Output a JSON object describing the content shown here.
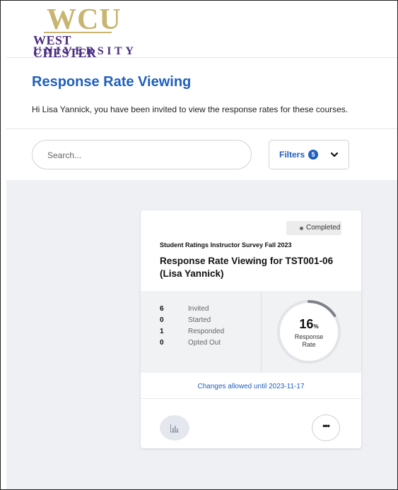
{
  "logo": {
    "mark": "WCU",
    "line1": "WEST CHESTER",
    "line2": "UNIVERSITY"
  },
  "page": {
    "title": "Response Rate Viewing",
    "intro": "Hi Lisa Yannick, you have been invited to view the response rates for these courses."
  },
  "search": {
    "placeholder": "Search..."
  },
  "filters": {
    "label": "Filters",
    "count": "5",
    "icon": "chevron-down-icon"
  },
  "card": {
    "status": "Completed",
    "survey_name": "Student Ratings Instructor Survey Fall 2023",
    "course_title": "Response Rate Viewing for TST001-06 (Lisa Yannick)",
    "stats": [
      {
        "value": "6",
        "label": "Invited"
      },
      {
        "value": "0",
        "label": "Started"
      },
      {
        "value": "1",
        "label": "Responded"
      },
      {
        "value": "0",
        "label": "Opted Out"
      }
    ],
    "response_rate": {
      "value": "16",
      "unit": "%",
      "fraction": 0.16,
      "label_line1": "Response",
      "label_line2": "Rate"
    },
    "changes_note": "Changes allowed until 2023-11-17",
    "chart_button_icon": "bar-chart-icon",
    "more_button_icon": "more-options-icon",
    "more_glyph": "•••"
  },
  "colors": {
    "brand_purple": "#4b2e83",
    "brand_gold": "#c9b470",
    "accent_blue": "#1f5fbf",
    "background_gray": "#eef0f3"
  }
}
